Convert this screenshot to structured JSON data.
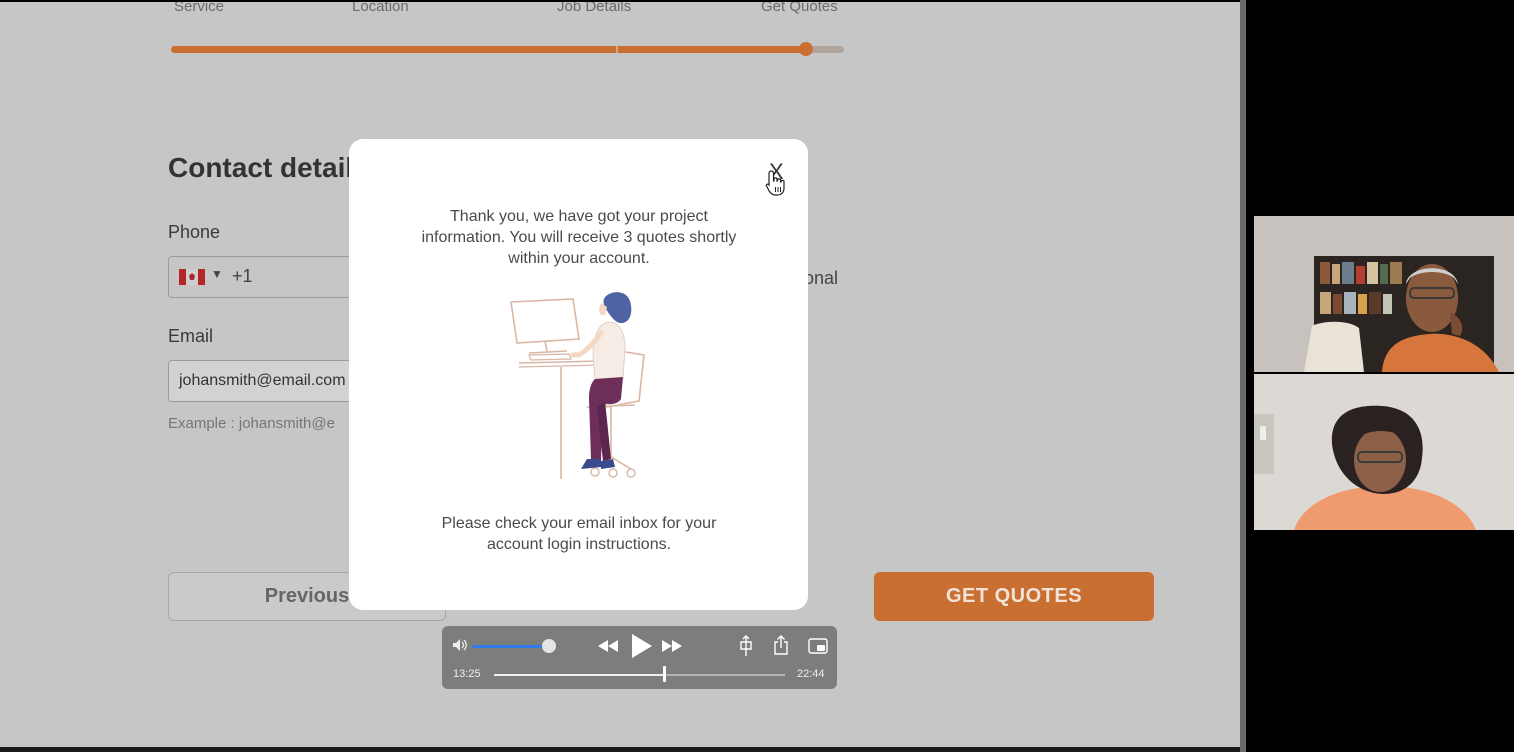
{
  "steps": [
    "Service",
    "Location",
    "Job Details",
    "Get Quotes"
  ],
  "progress": {
    "fraction": 0.94
  },
  "form": {
    "title": "Contact detail",
    "phone_label": "Phone",
    "phone_code": "+1",
    "email_label": "Email",
    "email_value": "johansmith@email.com",
    "email_example": "Example : johansmith@e",
    "optional_fragment": "ional",
    "previous_label": "Previous",
    "get_quotes_label": "GET QUOTES"
  },
  "modal": {
    "close_label": "X",
    "message": "Thank you, we have got your project information. You will receive 3 quotes shortly within your account.",
    "note": "Please check your email inbox for your account login instructions."
  },
  "player": {
    "current_time": "13:25",
    "total_time": "22:44",
    "volume_fraction": 0.9,
    "scrub_fraction": 0.59
  },
  "colors": {
    "accent": "#c86f31",
    "overlay_bg": "#c6c6c6",
    "volume_blue": "#2f7bea"
  }
}
